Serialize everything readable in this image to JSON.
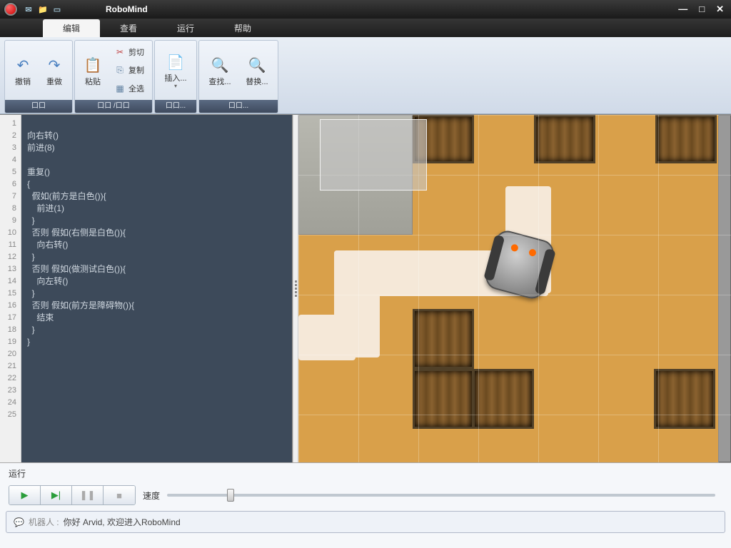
{
  "titlebar": {
    "app_title": "RoboMind",
    "min": "—",
    "max": "□",
    "close": "✕"
  },
  "menu": {
    "edit": "编辑",
    "view": "查看",
    "run": "运行",
    "help": "帮助"
  },
  "ribbon": {
    "undo": "撤销",
    "redo": "重做",
    "group1_label": "口口",
    "paste": "粘贴",
    "cut": "剪切",
    "copy": "复制",
    "select_all": "全选",
    "group2_label": "口口 /口口",
    "insert": "插入...",
    "group3_label": "口口...",
    "find": "查找...",
    "replace": "替换...",
    "group4_label": "口口..."
  },
  "code_lines": [
    "",
    "向右转()",
    "前进(8)",
    "",
    "重复()",
    "{",
    "  假如(前方是白色()){",
    "    前进(1)",
    "  }",
    "  否则 假如(右侧是白色()){",
    "    向右转()",
    "  }",
    "  否则 假如(做测试白色()){",
    "    向左转()",
    "  }",
    "  否则 假如(前方是障碍物()){",
    "    结束",
    "  }",
    "}",
    "",
    "",
    "",
    "",
    "",
    ""
  ],
  "run": {
    "label": "运行",
    "speed_label": "速度",
    "speed_percent": 11
  },
  "status": {
    "prefix": "机器人 :",
    "message": "你好 Arvid, 欢迎进入RoboMind"
  }
}
